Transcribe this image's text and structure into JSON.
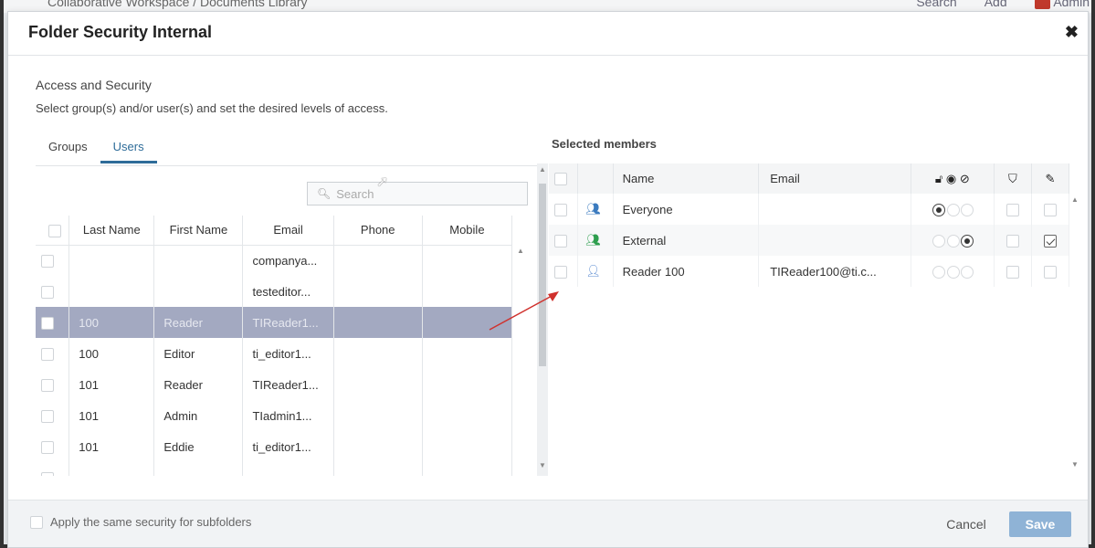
{
  "background": {
    "breadcrumb": "Collaborative Workspace / Documents Library",
    "search_label": "Search",
    "add_label": "Add",
    "user_label": "Admin"
  },
  "dialog": {
    "title": "Folder Security Internal",
    "section_title": "Access and Security",
    "section_desc": "Select group(s) and/or user(s) and set the desired levels of access.",
    "tabs": [
      {
        "label": "Groups",
        "active": false
      },
      {
        "label": "Users",
        "active": true
      }
    ],
    "search_placeholder": "Search",
    "users_table": {
      "headers": [
        "Last Name",
        "First Name",
        "Email",
        "Phone",
        "Mobile"
      ],
      "rows": [
        {
          "last": "",
          "first": "",
          "email": "companya...",
          "phone": "",
          "mobile": "",
          "selected": false
        },
        {
          "last": "",
          "first": "",
          "email": "testeditor...",
          "phone": "",
          "mobile": "",
          "selected": false
        },
        {
          "last": "100",
          "first": "Reader",
          "email": "TIReader1...",
          "phone": "",
          "mobile": "",
          "selected": true
        },
        {
          "last": "100",
          "first": "Editor",
          "email": "ti_editor1...",
          "phone": "",
          "mobile": "",
          "selected": false
        },
        {
          "last": "101",
          "first": "Reader",
          "email": "TIReader1...",
          "phone": "",
          "mobile": "",
          "selected": false
        },
        {
          "last": "101",
          "first": "Admin",
          "email": "TIadmin1...",
          "phone": "",
          "mobile": "",
          "selected": false
        },
        {
          "last": "101",
          "first": "Eddie",
          "email": "ti_editor1...",
          "phone": "",
          "mobile": "",
          "selected": false
        }
      ]
    },
    "selected_members_title": "Selected members",
    "members_table": {
      "headers": [
        "Name",
        "Email"
      ],
      "access_header_icons": [
        "lock-open-icon",
        "eye-icon",
        "no-access-icon"
      ],
      "bookmark_icon": "bookmark-icon",
      "edit_icon": "edit-icon",
      "rows": [
        {
          "type": "group",
          "icon_color": "#3b7bbf",
          "name": "Everyone",
          "email": "",
          "access": 0,
          "bookmark": false,
          "edit": false
        },
        {
          "type": "group",
          "icon_color": "#2e9e4e",
          "name": "External",
          "email": "",
          "access": 2,
          "bookmark": false,
          "edit": true
        },
        {
          "type": "user",
          "icon_color": "#5a8bd0",
          "name": "Reader 100",
          "email": "TIReader100@ti.c...",
          "access": -1,
          "bookmark": false,
          "edit": false
        }
      ]
    },
    "footer": {
      "apply_label": "Apply the same security for subfolders",
      "cancel_label": "Cancel",
      "save_label": "Save"
    },
    "colors": {
      "accent": "#2e6c99",
      "selected_row": "#a3a9c1",
      "save_button": "#8fb3d6",
      "annotation_arrow": "#d0312d"
    }
  }
}
